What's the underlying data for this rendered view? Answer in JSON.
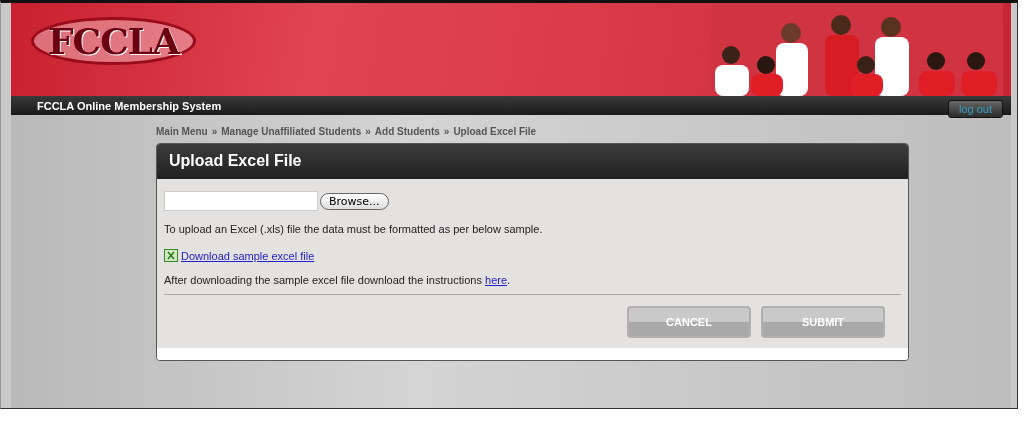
{
  "header": {
    "logo": "FCCLA"
  },
  "nav_bar": {
    "title": "FCCLA Online Membership System",
    "logout": "log out"
  },
  "breadcrumbs": {
    "separator": "»",
    "items": [
      "Main Menu",
      "Manage Unaffiliated Students",
      "Add Students",
      "Upload Excel File"
    ]
  },
  "panel": {
    "title": "Upload Excel File",
    "file_field": {
      "browse": "Browse..."
    },
    "instructions": "To upload an Excel (.xls) file the data must be formatted as per below sample.",
    "download_link": "Download sample excel file",
    "after_text": "After downloading the sample excel file download the instructions ",
    "after_link": "here",
    "after_end": ".",
    "buttons": [
      {
        "label": "CANCEL",
        "disabled": true
      },
      {
        "label": "SUBMIT",
        "disabled": true
      }
    ]
  }
}
